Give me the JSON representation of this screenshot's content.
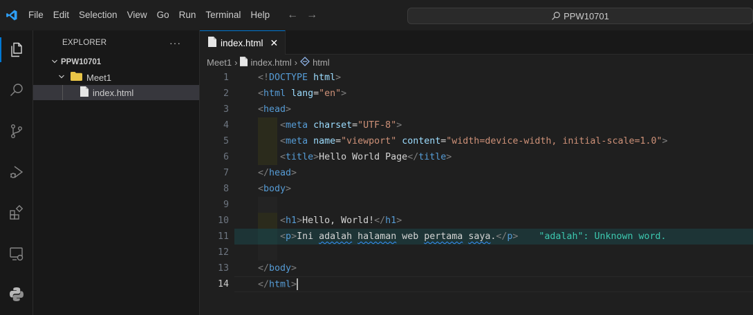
{
  "menu": [
    "File",
    "Edit",
    "Selection",
    "View",
    "Go",
    "Run",
    "Terminal",
    "Help"
  ],
  "search": {
    "text": "PPW10701"
  },
  "sidebar": {
    "title": "EXPLORER",
    "more": "···",
    "root": "PPW10701",
    "folder": "Meet1",
    "file": "index.html"
  },
  "tab": {
    "label": "index.html",
    "close": "✕"
  },
  "breadcrumb": {
    "folder": "Meet1",
    "file": "index.html",
    "symbol": "html",
    "sep": "›"
  },
  "code": {
    "line_numbers": [
      "1",
      "2",
      "3",
      "4",
      "5",
      "6",
      "7",
      "8",
      "9",
      "10",
      "11",
      "12",
      "13",
      "14"
    ],
    "current_line": "14",
    "diagnostic": "\"adalah\": Unknown word."
  },
  "colors": {
    "accent": "#0078d4",
    "folder": "#e8c547",
    "tag": "#569cd6",
    "attr": "#9cdcfe",
    "string": "#ce9178"
  },
  "icons": [
    "explorer-icon",
    "search-icon",
    "source-control-icon",
    "run-debug-icon",
    "extensions-icon",
    "remote-explorer-icon",
    "python-icon"
  ]
}
